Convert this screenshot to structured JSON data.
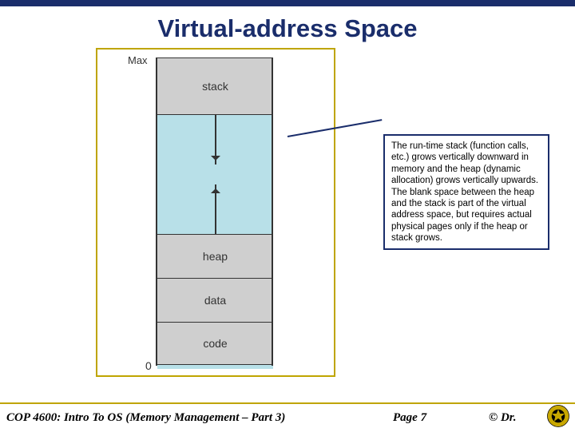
{
  "slide": {
    "title": "Virtual-address Space"
  },
  "diagram": {
    "label_max": "Max",
    "label_zero": "0",
    "segments": {
      "stack": "stack",
      "heap": "heap",
      "data": "data",
      "code": "code"
    }
  },
  "callout": {
    "text": "The run-time stack (function calls, etc.) grows vertically downward in memory and the heap (dynamic allocation) grows vertically upwards. The blank space between the heap and the stack is part of the virtual address space, but requires actual physical pages only if the heap or stack grows."
  },
  "footer": {
    "left": "COP 4600: Intro To OS  (Memory Management – Part 3)",
    "page": "Page 7",
    "right": "© Dr."
  }
}
